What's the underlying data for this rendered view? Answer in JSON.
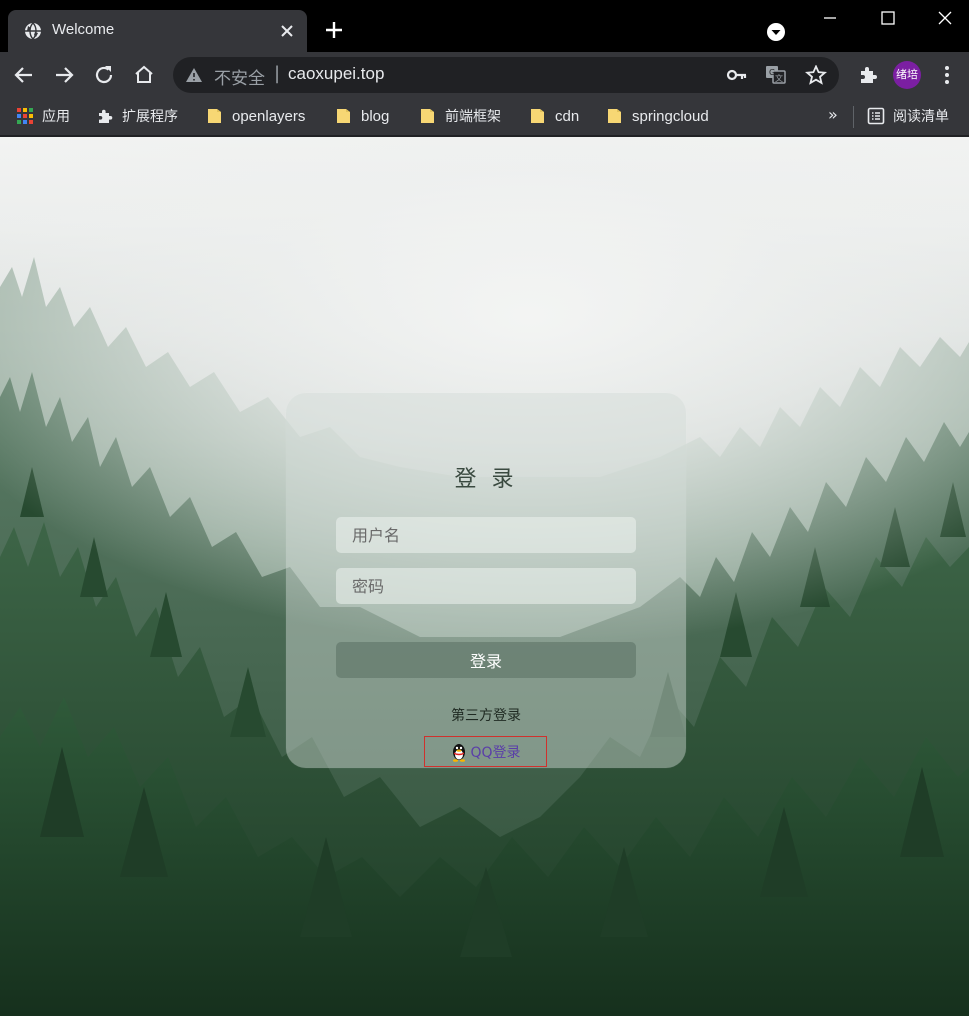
{
  "tab": {
    "title": "Welcome"
  },
  "omnibox": {
    "insecure_label": "不安全",
    "separator": "|",
    "url": "caoxupei.top"
  },
  "profile": {
    "initials": "绪培",
    "color": "#7b1fa2"
  },
  "bookmarks": {
    "items": [
      {
        "label": "应用",
        "icon": "apps-grid-icon"
      },
      {
        "label": "扩展程序",
        "icon": "puzzle-icon"
      },
      {
        "label": "openlayers",
        "icon": "folder-icon"
      },
      {
        "label": "blog",
        "icon": "folder-icon"
      },
      {
        "label": "前端框架",
        "icon": "folder-icon"
      },
      {
        "label": "cdn",
        "icon": "folder-icon"
      },
      {
        "label": "springcloud",
        "icon": "folder-icon"
      }
    ],
    "more": "»",
    "reading_list": "阅读清单"
  },
  "login": {
    "title": "登 录",
    "username_placeholder": "用户名",
    "password_placeholder": "密码",
    "submit_label": "登录",
    "third_party_label": "第三方登录",
    "qq_label": "QQ登录"
  },
  "colors": {
    "chrome_frame": "#000000",
    "toolbar": "#35363a",
    "omnibox": "#202124",
    "qq_link_border": "#d0312d",
    "qq_link_text": "#5a3ea8"
  }
}
